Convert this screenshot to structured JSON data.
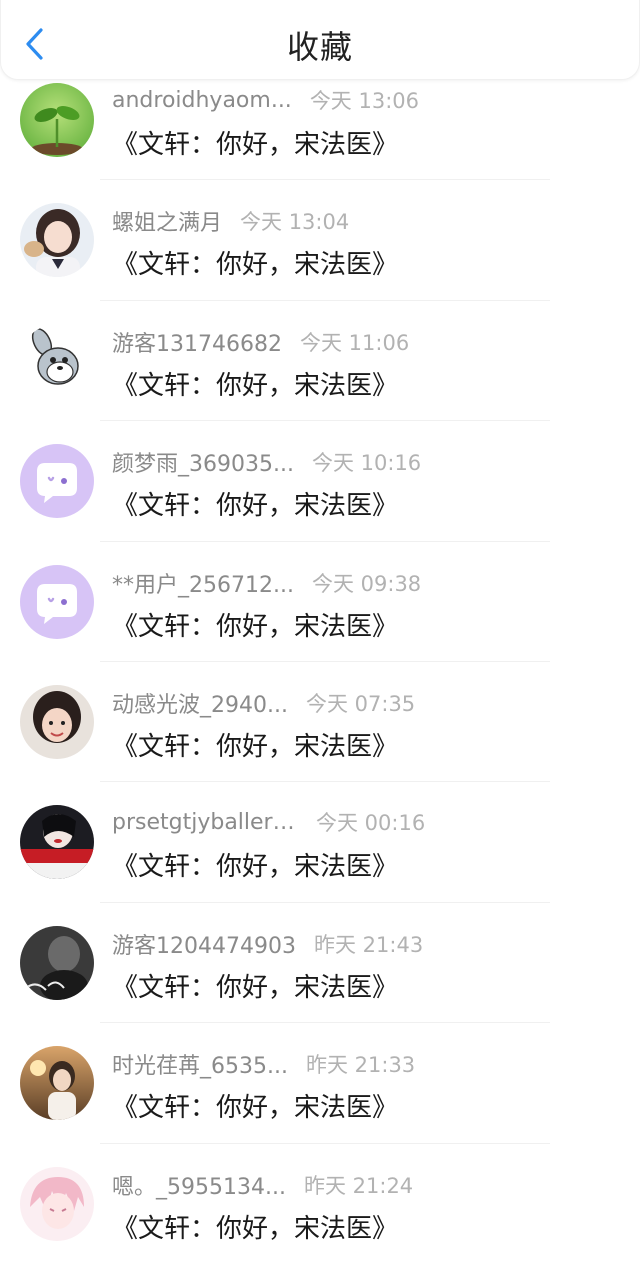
{
  "header": {
    "title": "收藏"
  },
  "items": [
    {
      "username": "androidhyaom...",
      "time": "今天 13:06",
      "book": "《文轩：你好，宋法医》",
      "avatar": "seedling-avatar"
    },
    {
      "username": "螺姐之满月",
      "time": "今天 13:04",
      "book": "《文轩：你好，宋法医》",
      "avatar": "girl-avatar"
    },
    {
      "username": "游客131746682",
      "time": "今天 11:06",
      "book": "《文轩：你好，宋法医》",
      "avatar": "cartoon-bunny-avatar"
    },
    {
      "username": "颜梦雨_369035...",
      "time": "今天 10:16",
      "book": "《文轩：你好，宋法医》",
      "avatar": "default-chat-avatar"
    },
    {
      "username": "**用户_256712...",
      "time": "今天 09:38",
      "book": "《文轩：你好，宋法医》",
      "avatar": "default-chat-avatar"
    },
    {
      "username": "动感光波_2940...",
      "time": "今天 07:35",
      "book": "《文轩：你好，宋法医》",
      "avatar": "child-avatar"
    },
    {
      "username": "prsetgtjyballeri...",
      "time": "今天 00:16",
      "book": "《文轩：你好，宋法医》",
      "avatar": "woman-red-avatar"
    },
    {
      "username": "游客1204474903",
      "time": "昨天 21:43",
      "book": "《文轩：你好，宋法医》",
      "avatar": "dark-bw-avatar"
    },
    {
      "username": "时光荏苒_6535...",
      "time": "昨天 21:33",
      "book": "《文轩：你好，宋法医》",
      "avatar": "sunset-girl-avatar"
    },
    {
      "username": "嗯。_5955134...",
      "time": "昨天 21:24",
      "book": "《文轩：你好，宋法医》",
      "avatar": "pink-anime-avatar"
    }
  ],
  "colors": {
    "accent": "#2d8cf0",
    "username": "#8a8a8a",
    "time": "#b2b2b2",
    "default_avatar_bg": "#d7c4f6"
  }
}
